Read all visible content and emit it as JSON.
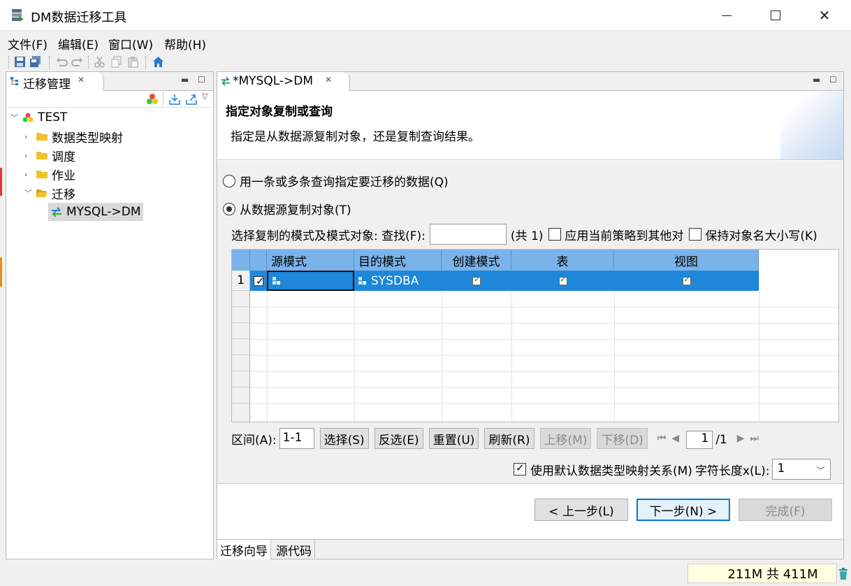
{
  "window": {
    "title": "DM数据迁移工具"
  },
  "menu": [
    "文件(F)",
    "编辑(E)",
    "窗口(W)",
    "帮助(H)"
  ],
  "left_panel": {
    "tab_label": "迁移管理",
    "tree": {
      "root": "TEST",
      "items": [
        "数据类型映射",
        "调度",
        "作业",
        "迁移"
      ],
      "child": "MYSQL->DM"
    }
  },
  "editor": {
    "tab_label": "*MYSQL->DM",
    "header": {
      "title": "指定对象复制或查询",
      "description": "指定是从数据源复制对象，还是复制查询结果。"
    },
    "options": {
      "query": "用一条或多条查询指定要迁移的数据(Q)",
      "copy": "从数据源复制对象(T)"
    },
    "find_row": {
      "label": "选择复制的模式及模式对象: 查找(F):",
      "count": "(共 1)",
      "apply_policy": "应用当前策略到其他对",
      "keep_case": "保持对象名大小写(K)"
    },
    "grid": {
      "columns": [
        "源模式",
        "目的模式",
        "创建模式",
        "表",
        "视图"
      ],
      "rows": [
        {
          "num": "1",
          "source": "",
          "target": "SYSDBA",
          "create": true,
          "table": true,
          "view": true
        }
      ]
    },
    "controls": {
      "range_label": "区间(A):",
      "range_value": "1-1",
      "buttons": [
        "选择(S)",
        "反选(E)",
        "重置(U)",
        "刷新(R)"
      ],
      "disabled_buttons": [
        "上移(M)",
        "下移(D)"
      ],
      "page": "1",
      "page_total": "/1"
    },
    "mapping": {
      "label": "使用默认数据类型映射关系(M)",
      "length_label": "字符长度x(L):",
      "length_value": "1"
    },
    "nav": {
      "prev": "< 上一步(L)",
      "next": "下一步(N) >",
      "finish": "完成(F)"
    },
    "bottom_tabs": [
      "迁移向导",
      "源代码"
    ]
  },
  "status": {
    "heap": "211M 共 411M"
  },
  "colors": {
    "grid_header": "#7ab3ea",
    "selected_row": "#1e87d9",
    "primary_border": "#0078d7"
  }
}
